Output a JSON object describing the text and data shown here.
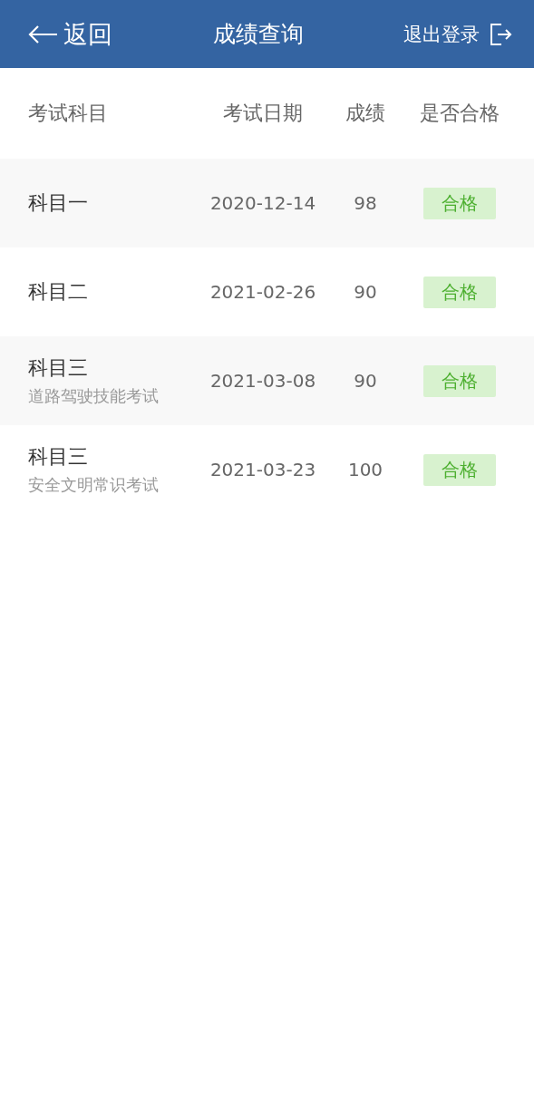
{
  "header": {
    "back": "返回",
    "title": "成绩查询",
    "logout": "退出登录"
  },
  "table": {
    "columns": [
      "考试科目",
      "考试日期",
      "成绩",
      "是否合格"
    ],
    "rows": [
      {
        "subject": "科目一",
        "date": "2020-12-14",
        "score": "98",
        "result": "合格"
      },
      {
        "subject": "科目二",
        "date": "2021-02-26",
        "score": "90",
        "result": "合格"
      },
      {
        "subject": "科目三",
        "note": "道路驾驶技能考试",
        "date": "2021-03-08",
        "score": "90",
        "result": "合格"
      },
      {
        "subject": "科目三",
        "note": "安全文明常识考试",
        "date": "2021-03-23",
        "score": "100",
        "result": "合格"
      }
    ]
  }
}
